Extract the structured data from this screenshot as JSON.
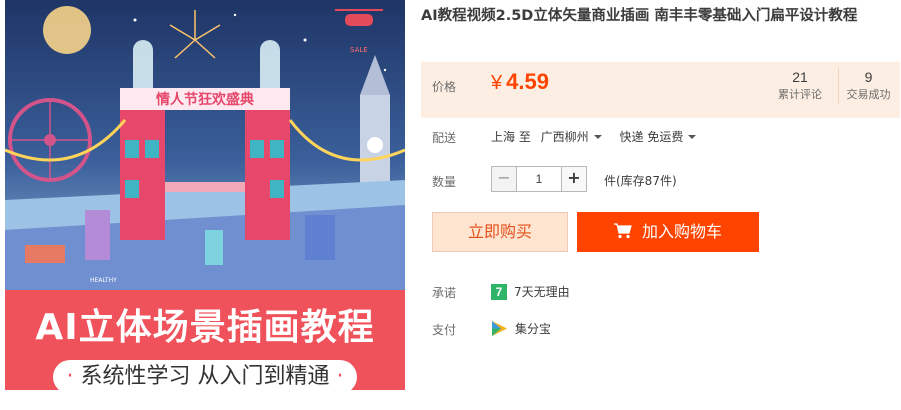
{
  "product": {
    "title": "AI教程视频2.5D立体矢量商业插画 南丰丰零基础入门扁平设计教程",
    "image": {
      "sign_text": "情人节狂欢盛典",
      "sale_tag": "SALE",
      "bus_text": "HEALTHY",
      "banner_title": "AI立体场景插画教程",
      "banner_subtitle": "系统性学习 从入门到精通"
    }
  },
  "price": {
    "label": "价格",
    "currency": "¥",
    "value": "4.59",
    "reviews_count": "21",
    "reviews_label": "累计评论",
    "sales_count": "9",
    "sales_label": "交易成功"
  },
  "shipping": {
    "label": "配送",
    "from": "上海 至",
    "destination": "广西柳州",
    "method": "快递 免运费"
  },
  "quantity": {
    "label": "数量",
    "value": "1",
    "minus": "−",
    "plus": "+",
    "stock_text": "件(库存87件)"
  },
  "actions": {
    "buy_now": "立即购买",
    "add_to_cart": "加入购物车"
  },
  "promise": {
    "label": "承诺",
    "icon_text": "7",
    "text": "7天无理由"
  },
  "payment": {
    "label": "支付",
    "text": "集分宝"
  },
  "colors": {
    "accent": "#ff4400",
    "price_bg": "#fdeee3",
    "buy_bg": "#ffe4d0",
    "promise_green": "#2fb56a"
  }
}
